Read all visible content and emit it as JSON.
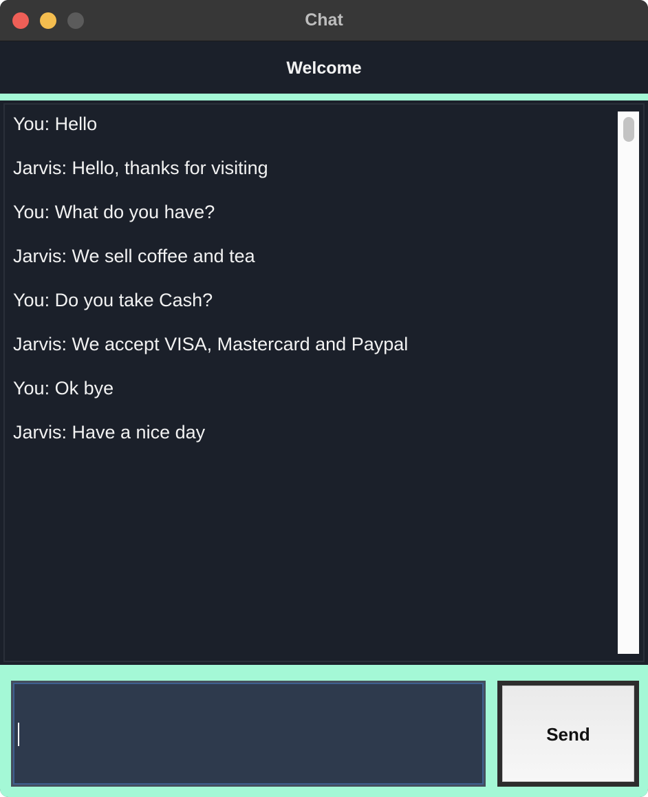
{
  "window": {
    "title": "Chat",
    "controls": [
      "close",
      "minimize",
      "zoom"
    ]
  },
  "header": {
    "title": "Welcome"
  },
  "chat": {
    "messages": [
      "You: Hello",
      "Jarvis: Hello, thanks for visiting",
      "You: What do you have?",
      "Jarvis: We sell coffee and tea",
      "You: Do you take Cash?",
      "Jarvis: We accept VISA, Mastercard and Paypal",
      "You: Ok bye",
      "Jarvis: Have a nice day"
    ]
  },
  "composer": {
    "input_value": "",
    "send_label": "Send"
  },
  "colors": {
    "accent": "#a4f8d6",
    "background": "#1b202a",
    "input_background": "#2e3a4d",
    "titlebar": "#373737"
  }
}
